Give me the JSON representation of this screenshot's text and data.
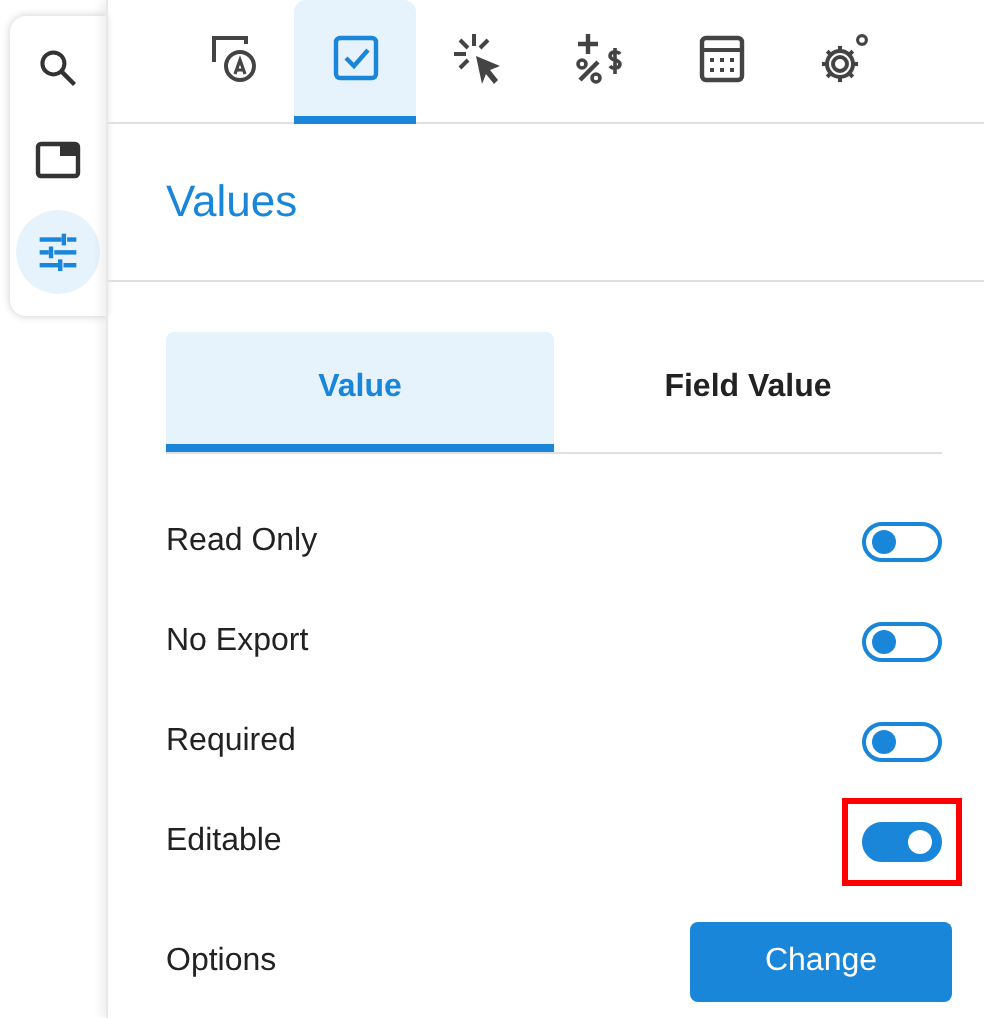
{
  "rail": [
    {
      "kind": "search",
      "selected": false
    },
    {
      "kind": "window",
      "selected": false
    },
    {
      "kind": "sliders",
      "selected": true
    }
  ],
  "tabs": [
    {
      "kind": "text-field",
      "selected": false
    },
    {
      "kind": "checkbox",
      "selected": true
    },
    {
      "kind": "click",
      "selected": false
    },
    {
      "kind": "calc-symbols",
      "selected": false
    },
    {
      "kind": "calculator",
      "selected": false
    },
    {
      "kind": "gears",
      "selected": false
    }
  ],
  "heading": "Values",
  "subtabs": [
    {
      "label": "Value",
      "selected": true
    },
    {
      "label": "Field Value",
      "selected": false
    }
  ],
  "toggles": [
    {
      "label": "Read Only",
      "on": false,
      "highlighted": false
    },
    {
      "label": "No Export",
      "on": false,
      "highlighted": false
    },
    {
      "label": "Required",
      "on": false,
      "highlighted": false
    },
    {
      "label": "Editable",
      "on": true,
      "highlighted": true
    }
  ],
  "options": {
    "label": "Options",
    "button": "Change"
  }
}
